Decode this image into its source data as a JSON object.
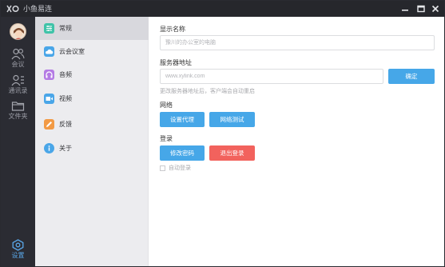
{
  "app": {
    "title": "小鱼易连"
  },
  "rail": {
    "items": [
      {
        "label": "会议",
        "icon": "people-icon"
      },
      {
        "label": "通讯录",
        "icon": "contacts-icon"
      },
      {
        "label": "文件夹",
        "icon": "folder-icon"
      }
    ],
    "settings": {
      "label": "设置",
      "icon": "settings-icon"
    }
  },
  "sidebar": {
    "items": [
      {
        "label": "常规",
        "icon": "general-icon",
        "color": "#3fc3a8"
      },
      {
        "label": "云会议室",
        "icon": "cloud-icon",
        "color": "#4aa6e8"
      },
      {
        "label": "音频",
        "icon": "headphone-icon",
        "color": "#b47be4"
      },
      {
        "label": "视频",
        "icon": "video-icon",
        "color": "#4aa6e8"
      },
      {
        "label": "反馈",
        "icon": "pencil-icon",
        "color": "#f29a45"
      },
      {
        "label": "关于",
        "icon": "info-icon",
        "color": "#4aa6e8"
      }
    ],
    "active_index": 0
  },
  "main": {
    "display_name": {
      "label": "显示名称",
      "placeholder": "豫川的办公室的电脑",
      "value": ""
    },
    "server": {
      "label": "服务器地址",
      "placeholder": "www.xylink.com",
      "value": "",
      "confirm_label": "确定",
      "hint": "更改服务器地址后，客户端会自动重启"
    },
    "network": {
      "label": "网络",
      "proxy_label": "设置代理",
      "test_label": "网络测试"
    },
    "login": {
      "label": "登录",
      "change_password_label": "修改密码",
      "logout_label": "退出登录",
      "auto_login_label": "自动登录",
      "auto_login_checked": false
    }
  },
  "colors": {
    "accent": "#46a7e8",
    "danger": "#f2625d",
    "rail_bg": "#2b2c33",
    "titlebar_bg": "#26272c"
  }
}
